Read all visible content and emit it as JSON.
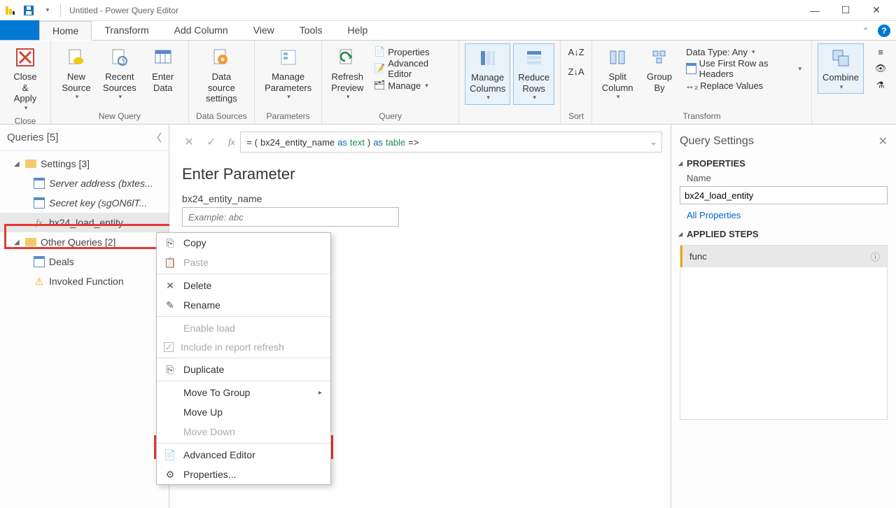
{
  "window": {
    "title": "Untitled - Power Query Editor"
  },
  "tabs": {
    "file": "",
    "home": "Home",
    "transform": "Transform",
    "addColumn": "Add Column",
    "view": "View",
    "tools": "Tools",
    "help": "Help"
  },
  "ribbon": {
    "close": {
      "closeApply": "Close &\nApply",
      "group": "Close"
    },
    "newQuery": {
      "newSource": "New\nSource",
      "recentSources": "Recent\nSources",
      "enterData": "Enter\nData",
      "group": "New Query"
    },
    "dataSources": {
      "settings": "Data source\nsettings",
      "group": "Data Sources"
    },
    "parameters": {
      "manage": "Manage\nParameters",
      "group": "Parameters"
    },
    "query": {
      "refresh": "Refresh\nPreview",
      "properties": "Properties",
      "advEditor": "Advanced Editor",
      "manage": "Manage",
      "group": "Query"
    },
    "columns": {
      "manageCols": "Manage\nColumns",
      "reduceRows": "Reduce\nRows"
    },
    "sort": {
      "group": "Sort"
    },
    "split": "Split\nColumn",
    "groupBy": "Group\nBy",
    "transform": {
      "dataType": "Data Type: Any",
      "firstRow": "Use First Row as Headers",
      "replace": "Replace Values",
      "group": "Transform"
    },
    "combine": "Combine"
  },
  "queriesPane": {
    "title": "Queries [5]",
    "folder1": "Settings [3]",
    "item1": "Server address (bxtes...",
    "item2": "Secret key (sgON6lT...",
    "item3": "bx24_load_entity",
    "folder2": "Other Queries [2]",
    "item4": "Deals",
    "item5": "Invoked Function"
  },
  "formula": {
    "prefix": "= (",
    "name": "bx24_entity_name",
    "as1": " as ",
    "text": "text",
    "paren": ") ",
    "as2": "as ",
    "table": "table",
    "arrow": " =>"
  },
  "param": {
    "title": "Enter Parameter",
    "label": "bx24_entity_name",
    "placeholder": "Example: abc",
    "sigFragment": "name as text) as table"
  },
  "contextMenu": {
    "copy": "Copy",
    "paste": "Paste",
    "delete": "Delete",
    "rename": "Rename",
    "enableLoad": "Enable load",
    "includeRefresh": "Include in report refresh",
    "duplicate": "Duplicate",
    "moveToGroup": "Move To Group",
    "moveUp": "Move Up",
    "moveDown": "Move Down",
    "advancedEditor": "Advanced Editor",
    "properties": "Properties..."
  },
  "settings": {
    "title": "Query Settings",
    "propsSection": "PROPERTIES",
    "nameLabel": "Name",
    "nameValue": "bx24_load_entity",
    "allProps": "All Properties",
    "stepsSection": "APPLIED STEPS",
    "step1": "func"
  }
}
